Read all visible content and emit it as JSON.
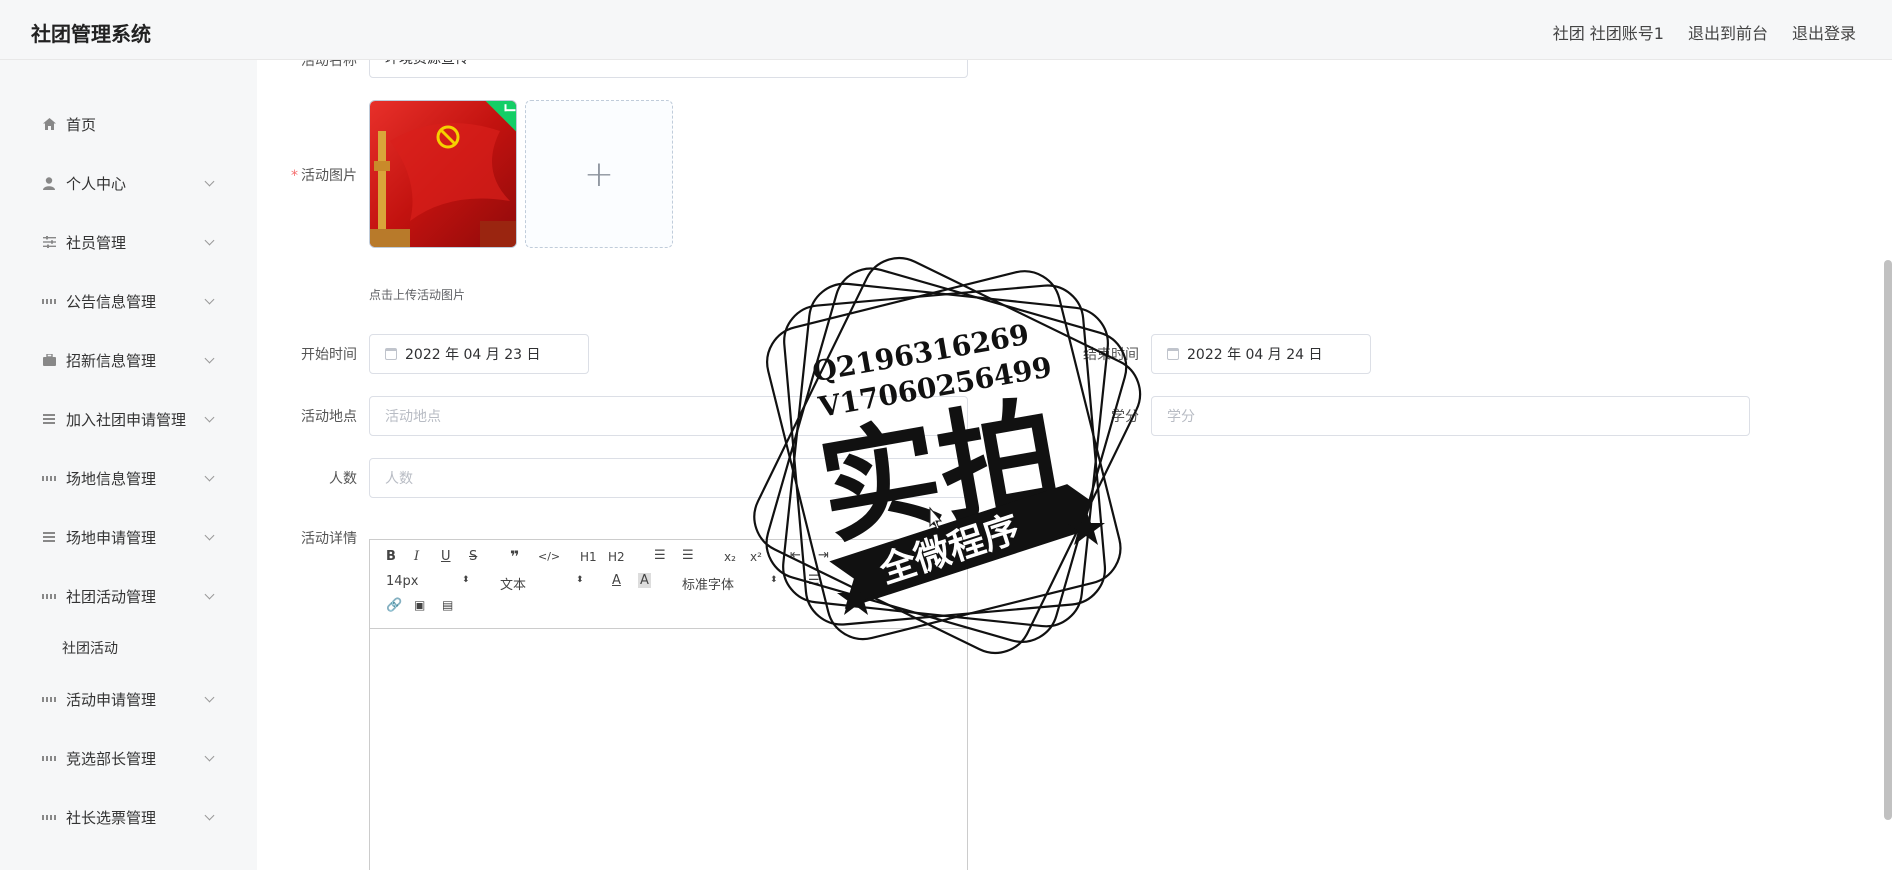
{
  "header": {
    "brand": "社团管理系统",
    "user": "社团 社团账号1",
    "exit_front": "退出到前台",
    "logout": "退出登录"
  },
  "sidebar": {
    "items": [
      {
        "label": "首页",
        "icon": "home-icon"
      },
      {
        "label": "个人中心",
        "icon": "user-icon"
      },
      {
        "label": "社员管理",
        "icon": "sliders-icon"
      },
      {
        "label": "公告信息管理",
        "icon": "grid-icon"
      },
      {
        "label": "招新信息管理",
        "icon": "briefcase-icon"
      },
      {
        "label": "加入社团申请管理",
        "icon": "list-icon"
      },
      {
        "label": "场地信息管理",
        "icon": "grid-icon"
      },
      {
        "label": "场地申请管理",
        "icon": "list-icon"
      },
      {
        "label": "社团活动管理",
        "icon": "grid-icon"
      },
      {
        "label": "社团活动",
        "icon": ""
      },
      {
        "label": "活动申请管理",
        "icon": "grid-icon"
      },
      {
        "label": "竞选部长管理",
        "icon": "grid-icon"
      },
      {
        "label": "社长选票管理",
        "icon": "grid-icon"
      }
    ]
  },
  "form": {
    "name_label": "活动名称",
    "name_value": "环境资源宣传",
    "image_label": "活动图片",
    "image_hint": "点击上传活动图片",
    "start_label": "开始时间",
    "start_value": "2022 年 04 月 23 日",
    "end_label": "结束时间",
    "end_value": "2022 年 04 月 24 日",
    "location_label": "活动地点",
    "location_placeholder": "活动地点",
    "credit_label": "学分",
    "credit_placeholder": "学分",
    "people_label": "人数",
    "people_placeholder": "人数",
    "detail_label": "活动详情"
  },
  "editor": {
    "font_size": "14px",
    "text_type": "文本",
    "font_family": "标准字体",
    "h1": "H1",
    "h2": "H2"
  },
  "watermark": {
    "qq": "Q2196316269",
    "wx": "V17060256499",
    "big": "实拍",
    "banner": "全微程序"
  },
  "colors": {
    "accent": "#409eff",
    "success": "#13ce66",
    "required": "#f56c6c"
  }
}
